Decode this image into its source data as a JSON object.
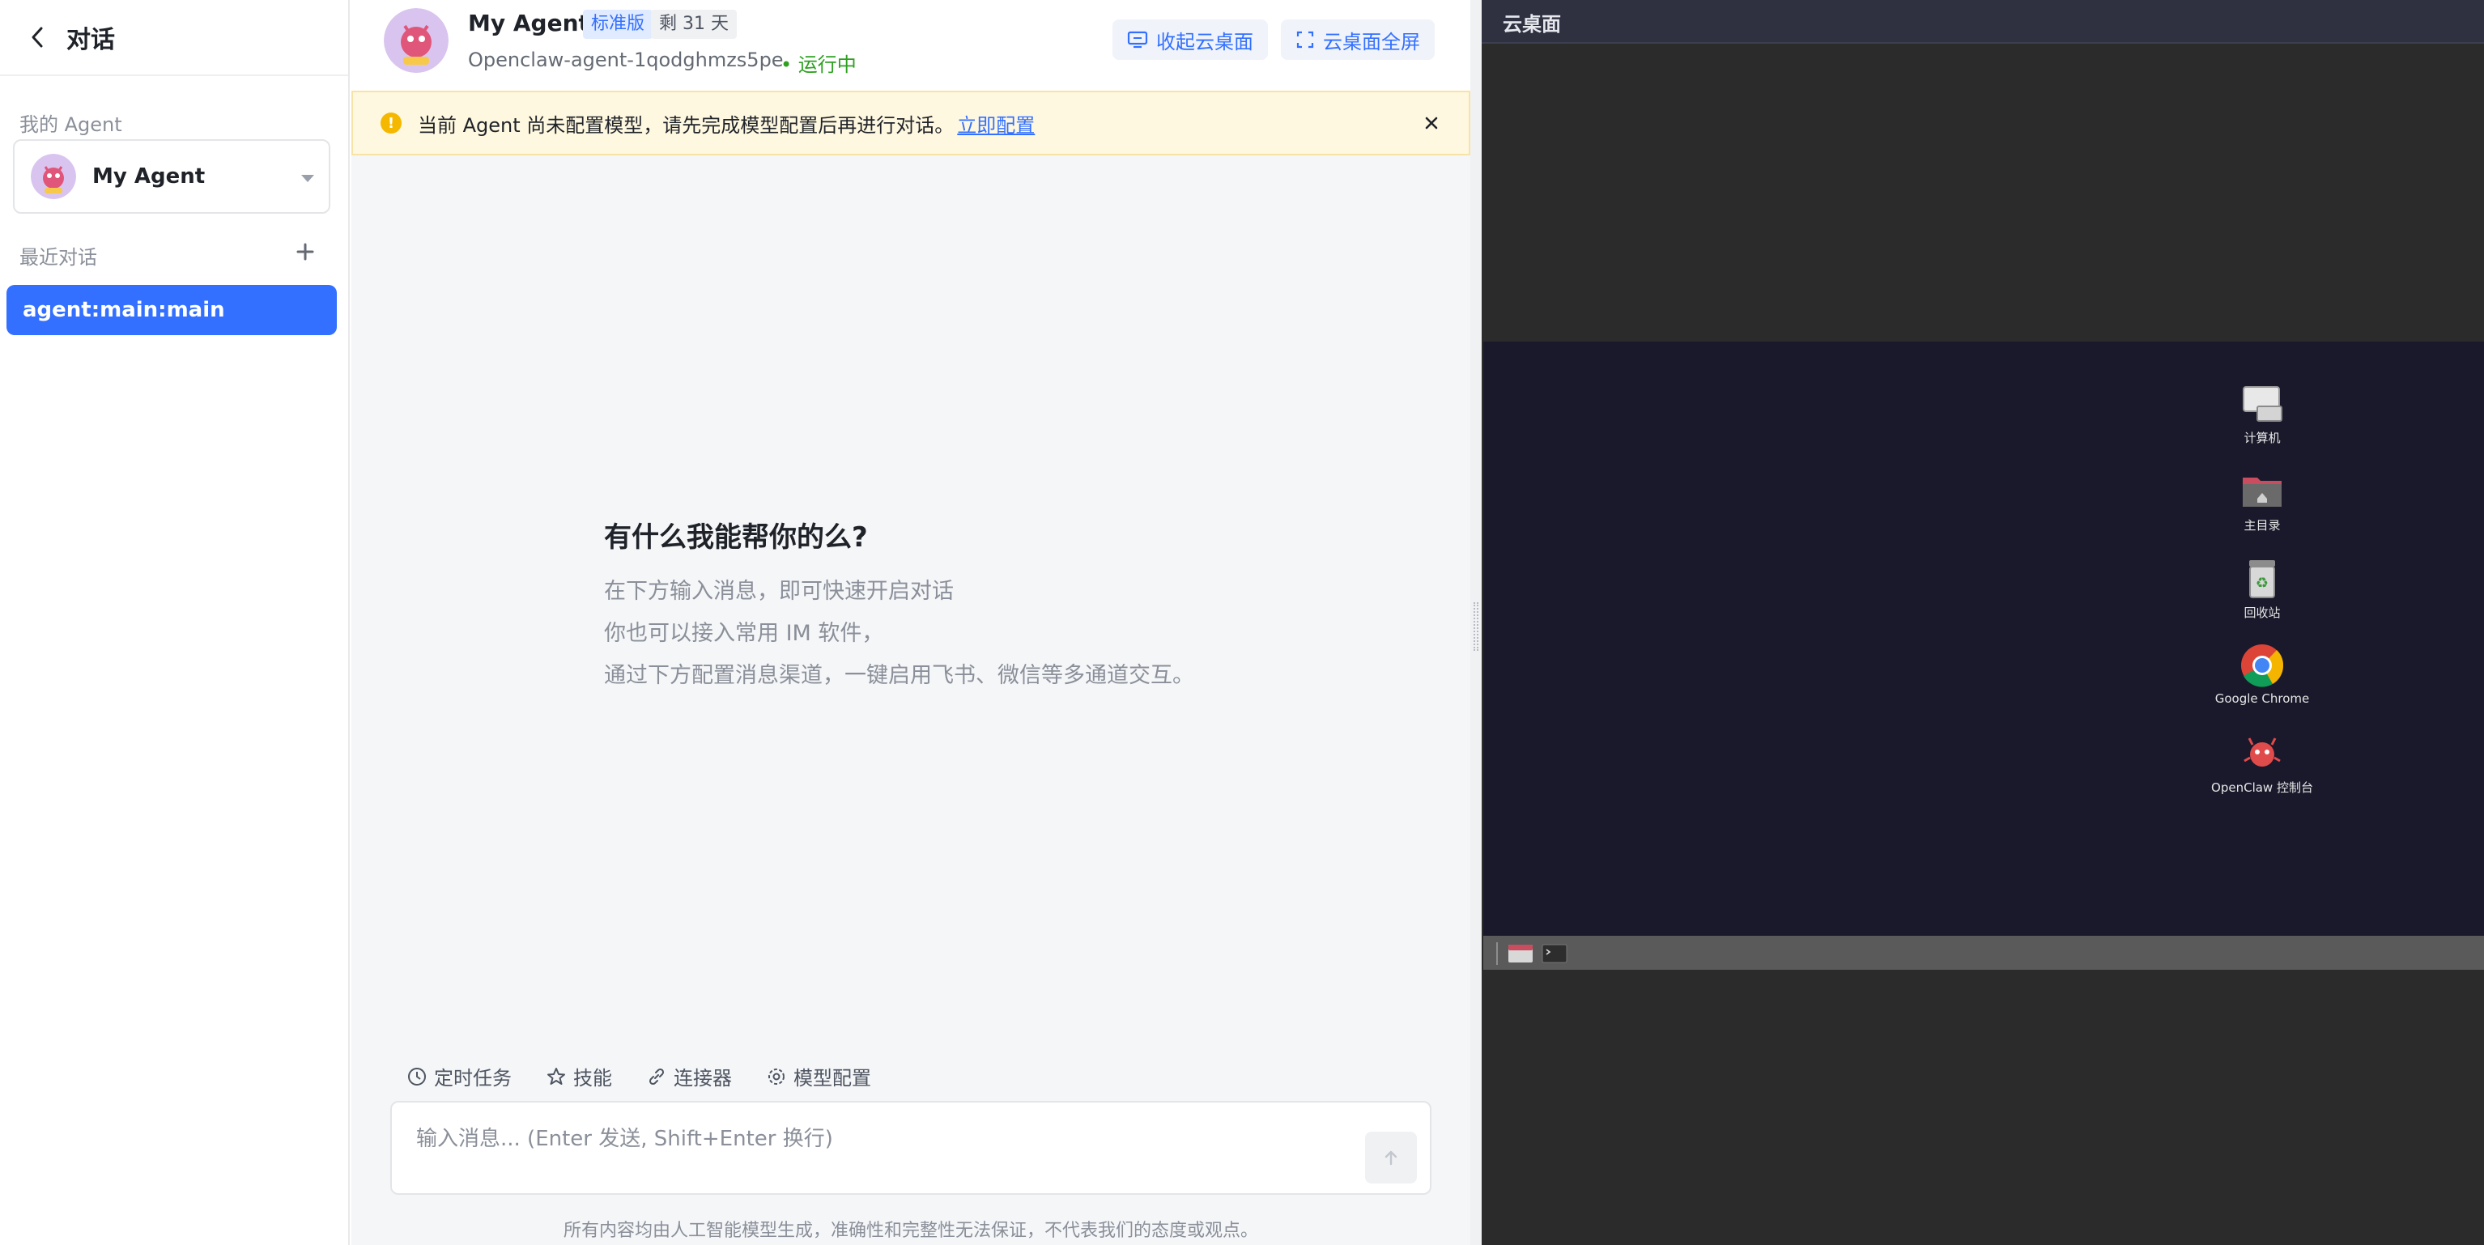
{
  "sidebar": {
    "title": "对话",
    "my_agent_label": "我的 Agent",
    "agent_name": "My Agent",
    "recent_label": "最近对话",
    "conversations": [
      "agent:main:main"
    ]
  },
  "header": {
    "agent_name": "My Agent",
    "plan_badge": "标准版",
    "days_left": "剩 31 天",
    "agent_id": "Openclaw-agent-1qodghmzs5pe",
    "status": "运行中",
    "collapse_button": "收起云桌面",
    "fullscreen_button": "云桌面全屏"
  },
  "notice": {
    "text": "当前 Agent 尚未配置模型，请先完成模型配置后再进行对话。",
    "link": "立即配置"
  },
  "welcome": {
    "title": "有什么我能帮你的么?",
    "lines": [
      "在下方输入消息，即可快速开启对话",
      "你也可以接入常用 IM 软件，",
      "通过下方配置消息渠道，一键启用飞书、微信等多通道交互。"
    ]
  },
  "toolbar": {
    "scheduled_tasks": "定时任务",
    "skills": "技能",
    "connectors": "连接器",
    "model_config": "模型配置"
  },
  "input": {
    "placeholder": "输入消息... (Enter 发送, Shift+Enter 换行)"
  },
  "disclaimer": "所有内容均由人工智能模型生成，准确性和完整性无法保证，不代表我们的态度或观点。",
  "cloud_desktop": {
    "title": "云桌面",
    "icons": [
      {
        "label": "计算机",
        "icon": "computer-icon"
      },
      {
        "label": "主目录",
        "icon": "home-folder-icon"
      },
      {
        "label": "回收站",
        "icon": "trash-icon"
      },
      {
        "label": "Google Chrome",
        "icon": "chrome-icon"
      },
      {
        "label": "OpenClaw 控制台",
        "icon": "openclaw-icon"
      }
    ]
  },
  "colors": {
    "accent": "#3370ff",
    "status_green": "#2ea121",
    "warning_bg": "#fff8e0",
    "desktop_bg": "#19192b"
  }
}
